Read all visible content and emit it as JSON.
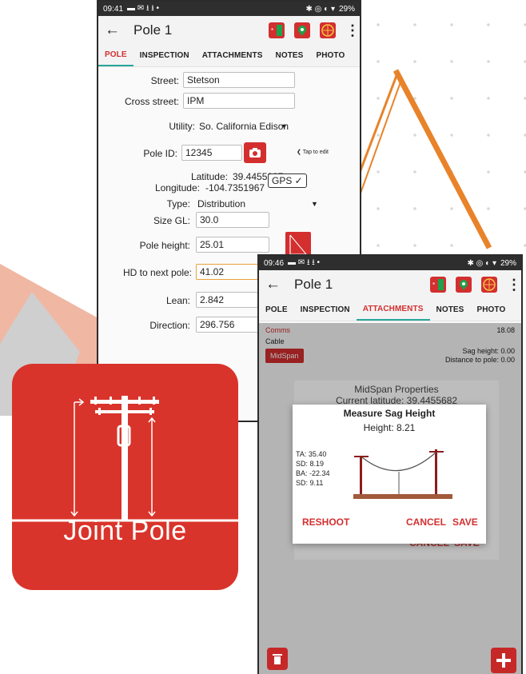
{
  "phone1": {
    "status": {
      "time": "09:41",
      "battery": "29%"
    },
    "title": "Pole 1",
    "tabs": [
      "POLE",
      "INSPECTION",
      "ATTACHMENTS",
      "NOTES",
      "PHOTO"
    ],
    "form": {
      "street_label": "Street:",
      "street": "Stetson",
      "cross_label": "Cross street:",
      "cross": "IPM",
      "utility_label": "Utility:",
      "utility": "So. California Edison",
      "poleid_label": "Pole ID:",
      "poleid": "12345",
      "tap_hint": "Tap to edit",
      "lat_label": "Latitude:",
      "lat": "39.4455237",
      "lon_label": "Longitude:",
      "lon": "-104.7351967",
      "gps_button": "GPS ✓",
      "type_label": "Type:",
      "type": "Distribution",
      "size_label": "Size GL:",
      "size": "30.0",
      "height_label": "Pole height:",
      "height": "25.01",
      "hd_label": "HD to next pole:",
      "hd": "41.02",
      "lean_label": "Lean:",
      "lean": "2.842",
      "dir_label": "Direction:",
      "dir": "296.756"
    }
  },
  "phone2": {
    "status": {
      "time": "09:46",
      "battery": "29%"
    },
    "title": "Pole 1",
    "tabs": [
      "POLE",
      "INSPECTION",
      "ATTACHMENTS",
      "NOTES",
      "PHOTO"
    ],
    "attachment": {
      "category": "Comms",
      "value": "18.08",
      "type": "Cable",
      "chip": "MidSpan",
      "sag": "Sag height: 0.00",
      "distance": "Distance to pole: 0.00"
    },
    "midspan_dialog": {
      "title": "MidSpan Properties",
      "latitude": "Current latitude: 39.4455682",
      "cancel": "CANCEL",
      "save": "SAVE"
    },
    "sag_dialog": {
      "title": "Measure Sag Height",
      "height": "Height: 8.21",
      "readings": [
        "TA: 35.40",
        "SD: 8.19",
        "BA: -22.34",
        "SD: 9.11"
      ],
      "reshoot": "RESHOOT",
      "cancel": "CANCEL",
      "save": "SAVE"
    }
  },
  "logo": {
    "text": "Joint Pole",
    "color": "#d9342b"
  },
  "colors": {
    "accent_red": "#d32f2f",
    "tab_underline": "#26a69a",
    "focus": "#e9a23b"
  }
}
